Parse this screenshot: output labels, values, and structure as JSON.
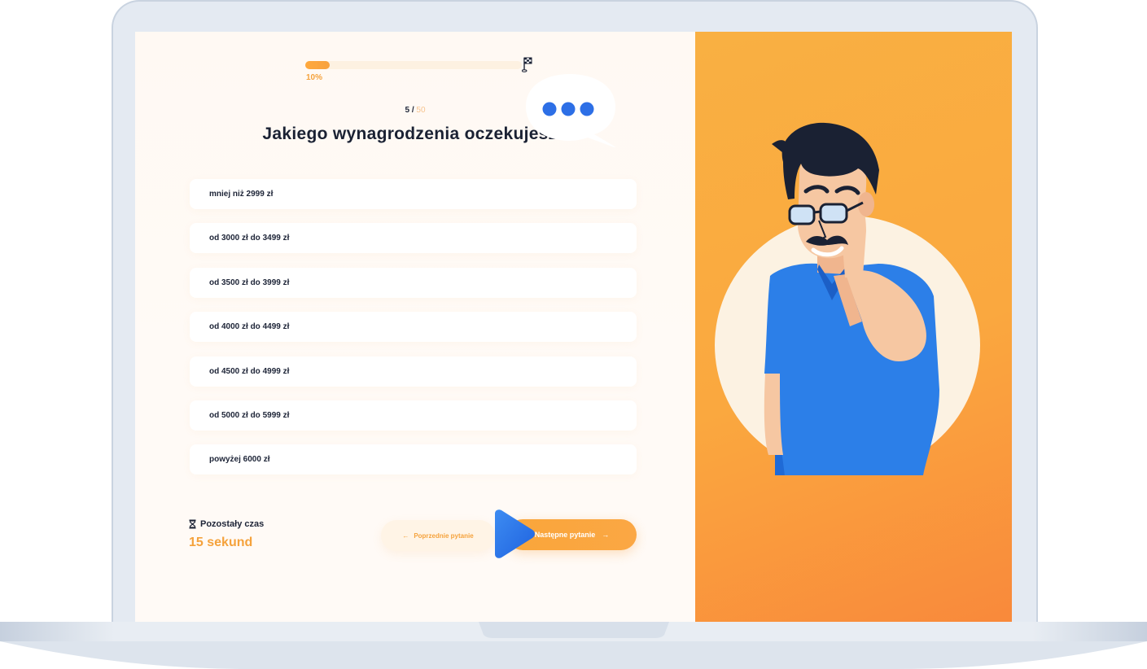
{
  "progress": {
    "value": 0.1,
    "label": "10%"
  },
  "counter": {
    "current": "5",
    "separator": " / ",
    "total": "50"
  },
  "question": "Jakiego wynagrodzenia oczekujesz?",
  "answers": [
    "mniej niż 2999 zł",
    "od 3000 zł do 3499 zł",
    "od 3500 zł do 3999 zł",
    "od 4000 zł do 4499 zł",
    "od 4500 zł do 4999 zł",
    "od 5000 zł do 5999 zł",
    "powyżej 6000 zł"
  ],
  "timer": {
    "icon": "hourglass-icon",
    "label": "Pozostały czas",
    "value": "15 sekund"
  },
  "nav": {
    "prev_label": "Poprzednie pytanie",
    "next_label": "Następne pytanie"
  },
  "colors": {
    "accent": "#f5a23c",
    "text": "#1d2437",
    "panel": "#f9a63a",
    "shirt": "#2b7be8"
  }
}
